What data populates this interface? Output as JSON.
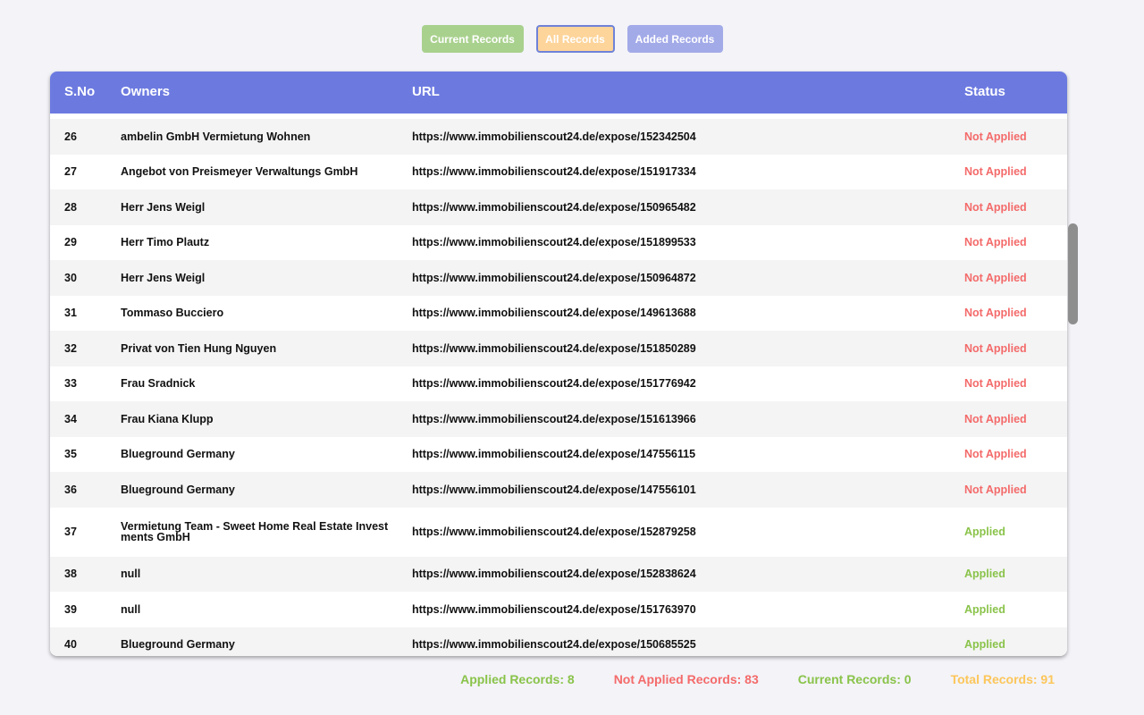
{
  "tabs": {
    "current": "Current Records",
    "all": "All Records",
    "added": "Added Records"
  },
  "table": {
    "headers": {
      "sno": "S.No",
      "owners": "Owners",
      "url": "URL",
      "status": "Status"
    },
    "rows": [
      {
        "sno": "26",
        "owner": "ambelin GmbH Vermietung Wohnen",
        "url": "https://www.immobilienscout24.de/expose/152342504",
        "status": "Not Applied"
      },
      {
        "sno": "27",
        "owner": "Angebot von Preismeyer Verwaltungs GmbH",
        "url": "https://www.immobilienscout24.de/expose/151917334",
        "status": "Not Applied"
      },
      {
        "sno": "28",
        "owner": "Herr Jens Weigl",
        "url": "https://www.immobilienscout24.de/expose/150965482",
        "status": "Not Applied"
      },
      {
        "sno": "29",
        "owner": "Herr Timo Plautz",
        "url": "https://www.immobilienscout24.de/expose/151899533",
        "status": "Not Applied"
      },
      {
        "sno": "30",
        "owner": "Herr Jens Weigl",
        "url": "https://www.immobilienscout24.de/expose/150964872",
        "status": "Not Applied"
      },
      {
        "sno": "31",
        "owner": "Tommaso Bucciero",
        "url": "https://www.immobilienscout24.de/expose/149613688",
        "status": "Not Applied"
      },
      {
        "sno": "32",
        "owner": "Privat von Tien Hung Nguyen",
        "url": "https://www.immobilienscout24.de/expose/151850289",
        "status": "Not Applied"
      },
      {
        "sno": "33",
        "owner": "Frau Sradnick",
        "url": "https://www.immobilienscout24.de/expose/151776942",
        "status": "Not Applied"
      },
      {
        "sno": "34",
        "owner": "Frau Kiana Klupp",
        "url": "https://www.immobilienscout24.de/expose/151613966",
        "status": "Not Applied"
      },
      {
        "sno": "35",
        "owner": "Blueground Germany",
        "url": "https://www.immobilienscout24.de/expose/147556115",
        "status": "Not Applied"
      },
      {
        "sno": "36",
        "owner": "Blueground Germany",
        "url": "https://www.immobilienscout24.de/expose/147556101",
        "status": "Not Applied"
      },
      {
        "sno": "37",
        "owner": "Vermietung Team - Sweet Home Real Estate Invest ments GmbH",
        "url": "https://www.immobilienscout24.de/expose/152879258",
        "status": "Applied"
      },
      {
        "sno": "38",
        "owner": "null",
        "url": "https://www.immobilienscout24.de/expose/152838624",
        "status": "Applied"
      },
      {
        "sno": "39",
        "owner": "null",
        "url": "https://www.immobilienscout24.de/expose/151763970",
        "status": "Applied"
      },
      {
        "sno": "40",
        "owner": "Blueground Germany",
        "url": "https://www.immobilienscout24.de/expose/150685525",
        "status": "Applied"
      }
    ]
  },
  "footer": {
    "applied": "Applied Records: 8",
    "not_applied": "Not Applied Records: 83",
    "current": "Current Records: 0",
    "total": "Total Records: 91"
  },
  "colors": {
    "header": "#6c7ae0",
    "applied": "#8ac34a",
    "not_applied": "#f46a6a",
    "total": "#fcc65a",
    "tab_current": "#a9d18e",
    "tab_all": "#fdd49a",
    "tab_added": "#a3aae8"
  }
}
